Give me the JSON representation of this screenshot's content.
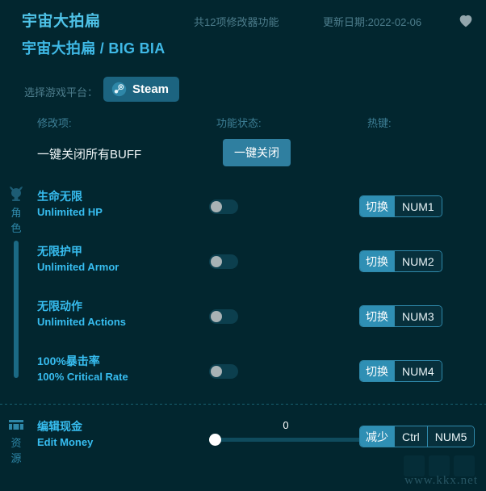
{
  "header": {
    "title_main": "宇宙大拍扁",
    "title_sub": "宇宙大拍扁 / BIG BIA",
    "feature_count": "共12项修改器功能",
    "update_date": "更新日期:2022-02-06",
    "favorite_icon": "heart-icon"
  },
  "platform": {
    "label": "选择游戏平台：",
    "button_label": "Steam",
    "button_icon": "steam-icon"
  },
  "columns": {
    "modifier": "修改项:",
    "state": "功能状态:",
    "hotkey": "热键:"
  },
  "onekey": {
    "name": "一键关闭所有BUFF",
    "button_label": "一键关闭"
  },
  "sections": [
    {
      "icon": "character-helmet-icon",
      "label": "角色",
      "rows": [
        {
          "cn": "生命无限",
          "en": "Unlimited HP",
          "control": "toggle",
          "toggle_on": false,
          "hotkey": {
            "action": "切换",
            "keys": [
              "NUM1"
            ]
          }
        },
        {
          "cn": "无限护甲",
          "en": "Unlimited Armor",
          "control": "toggle",
          "toggle_on": false,
          "hotkey": {
            "action": "切换",
            "keys": [
              "NUM2"
            ]
          }
        },
        {
          "cn": "无限动作",
          "en": "Unlimited Actions",
          "control": "toggle",
          "toggle_on": false,
          "hotkey": {
            "action": "切换",
            "keys": [
              "NUM3"
            ]
          }
        },
        {
          "cn": "100%暴击率",
          "en": "100% Critical Rate",
          "control": "toggle",
          "toggle_on": false,
          "hotkey": {
            "action": "切换",
            "keys": [
              "NUM4"
            ]
          }
        }
      ]
    },
    {
      "icon": "treasure-chest-icon",
      "label": "资源",
      "rows": [
        {
          "cn": "编辑现金",
          "en": "Edit Money",
          "control": "slider",
          "slider_value": "0",
          "slider_percent": 0,
          "hotkey": {
            "action": "减少",
            "keys": [
              "Ctrl",
              "NUM5"
            ]
          }
        }
      ]
    }
  ],
  "watermark": "www.kkx.net",
  "colors": {
    "background": "#02262f",
    "accent_cyan": "#37bdf0",
    "title_cyan": "#4fc3e8",
    "button_teal": "#2f7fa0",
    "muted": "#4d7d8c"
  }
}
